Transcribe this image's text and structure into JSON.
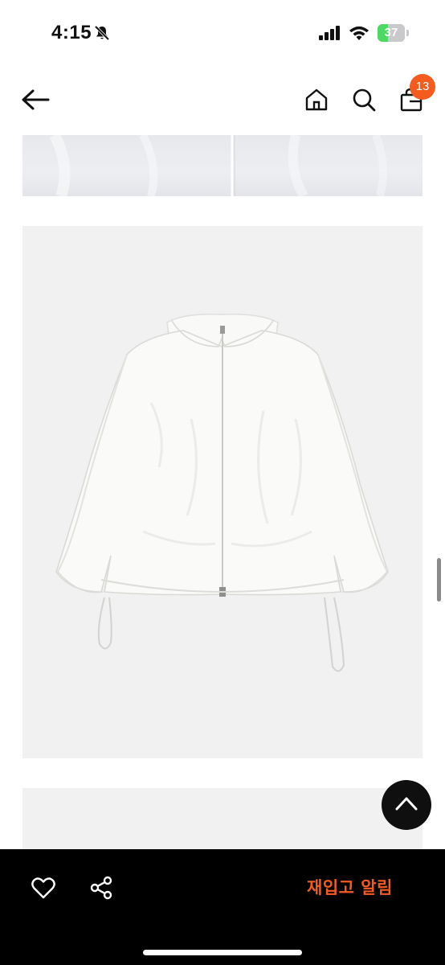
{
  "status_bar": {
    "time": "4:15",
    "battery_percent": "37",
    "battery_level": 0.37
  },
  "header": {
    "cart_count": "13"
  },
  "icons": {
    "back": "arrow-left-icon",
    "home": "home-icon",
    "search": "search-icon",
    "cart": "shopping-bag-icon",
    "scroll_top": "chevron-up-icon",
    "like": "heart-icon",
    "share": "share-icon"
  },
  "bottom_bar": {
    "restock_alert_label": "재입고 알림"
  },
  "colors": {
    "accent": "#f55a1e",
    "bottom_bar_bg": "#000000",
    "image_bg": "#f1f1f1"
  }
}
